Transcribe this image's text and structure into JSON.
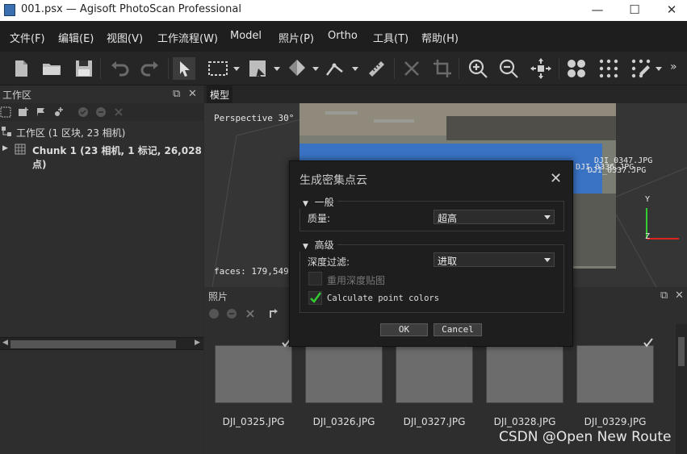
{
  "window": {
    "title": "001.psx — Agisoft PhotoScan Professional",
    "minimize": "—",
    "maximize": "☐",
    "close": "✕"
  },
  "menu": {
    "items": [
      "文件(F)",
      "编辑(E)",
      "视图(V)",
      "工作流程(W)",
      "Model",
      "照片(P)",
      "Ortho",
      "工具(T)",
      "帮助(H)"
    ]
  },
  "toolbar": {
    "icons": [
      "new-document-icon",
      "open-folder-icon",
      "save-icon",
      "undo-icon",
      "redo-icon",
      "navigation-cursor-icon",
      "rectangle-selection-icon",
      "resize-region-icon",
      "rotate-object-icon",
      "ruler-draw-icon",
      "measure-icon",
      "delete-icon",
      "crop-icon",
      "zoom-in-icon",
      "zoom-out-icon",
      "move-center-icon",
      "point-view-icon",
      "dense-cloud-icon",
      "classify-icon",
      "more-icon"
    ],
    "overflow": "»"
  },
  "workspace": {
    "title": "工作区",
    "root_label": "工作区 (1 区块, 23 相机)",
    "chunk_label": "Chunk 1 (23 相机, 1 标记, 26,028 点)"
  },
  "model": {
    "tab_label": "模型",
    "perspective": "Perspective 30°",
    "faces": "faces: 179,549 v",
    "overlay_labels": [
      "DJI_0347.JPG",
      "DJI_0336.JPG",
      "DJI_0337.JPG"
    ],
    "axis_y": "Y",
    "axis_z": "Z"
  },
  "photos": {
    "title": "照片",
    "items": [
      {
        "name": "DJI_0325.JPG"
      },
      {
        "name": "DJI_0326.JPG"
      },
      {
        "name": "DJI_0327.JPG"
      },
      {
        "name": "DJI_0328.JPG"
      },
      {
        "name": "DJI_0329.JPG"
      }
    ]
  },
  "dialog": {
    "title": "生成密集点云",
    "general_group": "一般",
    "quality_label": "质量:",
    "quality_value": "超高",
    "advanced_group": "高级",
    "depth_filter_label": "深度过滤:",
    "depth_filter_value": "进取",
    "reuse_depth_label": "重用深度贴图",
    "reuse_depth_checked": false,
    "calc_colors_label": "Calculate point colors",
    "calc_colors_checked": true,
    "ok_label": "OK",
    "cancel_label": "Cancel"
  },
  "watermark": "CSDN @Open New Route",
  "colors": {
    "accent_green": "#33cc33",
    "dialog_bg": "#1e1e1e",
    "model_blue": "#3a73c4"
  }
}
